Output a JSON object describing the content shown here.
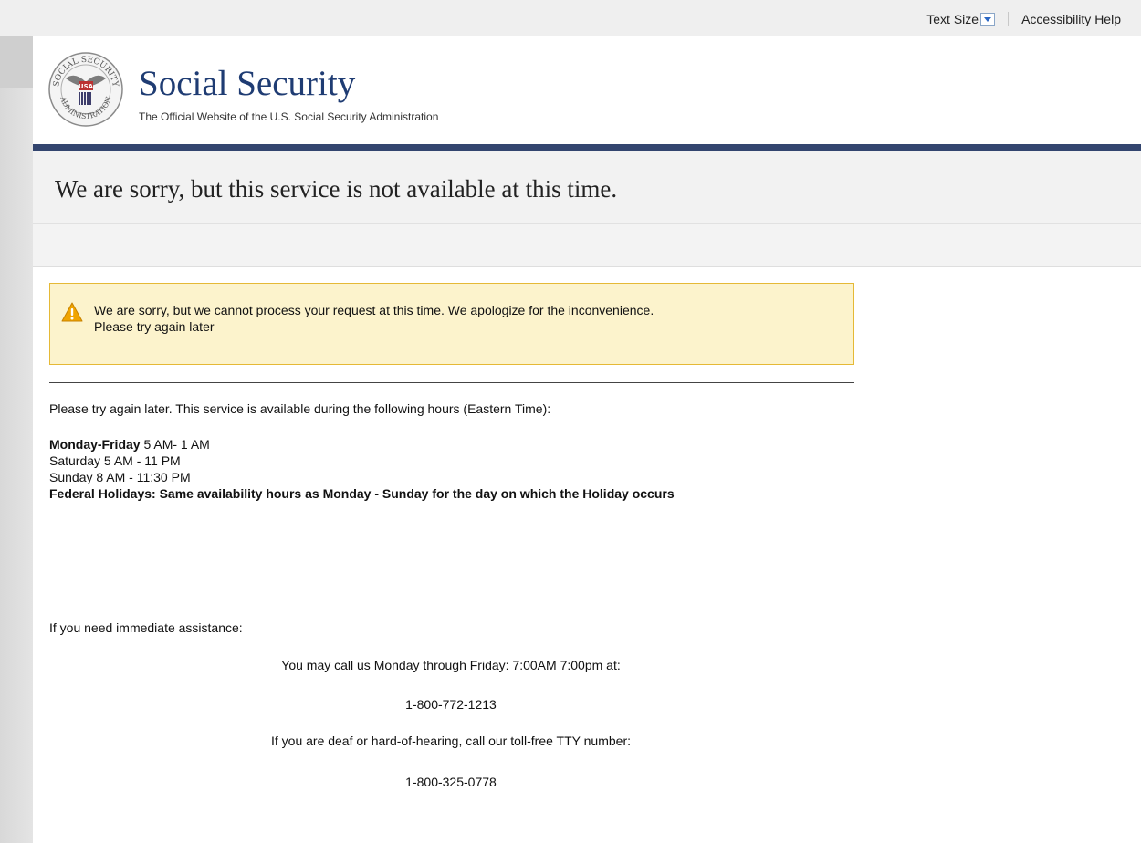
{
  "topbar": {
    "text_size_label": "Text Size",
    "accessibility_help": "Accessibility Help"
  },
  "header": {
    "site_title": "Social Security",
    "tagline": "The Official Website of the U.S. Social Security Administration",
    "seal_text": [
      "SOCIAL SECURITY",
      "USA",
      "ADMINISTRATION"
    ]
  },
  "page": {
    "title": "We are sorry, but this service is not available at this time."
  },
  "alert": {
    "line1": "We are sorry, but we cannot process your request at this time. We apologize for the inconvenience.",
    "line2": "Please try again later"
  },
  "body": {
    "intro": "Please try again later. This service is available during the following hours (Eastern Time):",
    "hours": [
      {
        "day": "Monday-Friday",
        "time": " 5 AM- 1 AM",
        "bold_day": true
      },
      {
        "day": "Saturday",
        "time": " 5 AM - 11 PM",
        "bold_day": false
      },
      {
        "day": "Sunday",
        "time": " 8 AM - 11:30 PM",
        "bold_day": false
      }
    ],
    "federal_holidays": "Federal Holidays: Same availability hours as Monday - Sunday for the day on which the Holiday occurs",
    "assist_label": "If you need immediate assistance:",
    "call_line": "You may call us Monday through Friday: 7:00AM 7:00pm at:",
    "phone_main": "1-800-772-1213",
    "tty_line": "If you are deaf or hard-of-hearing, call our toll-free TTY number:",
    "phone_tty": "1-800-325-0778"
  },
  "colors": {
    "brand_navy": "#1f3c73",
    "nav_bar": "#33456f",
    "alert_bg": "#fcf3cc",
    "alert_border": "#e5b936",
    "warning_icon": "#f0a400"
  },
  "icons": {
    "seal": "ssa-seal-icon",
    "warning": "warning-triangle-icon",
    "dropdown": "chevron-down-icon"
  }
}
